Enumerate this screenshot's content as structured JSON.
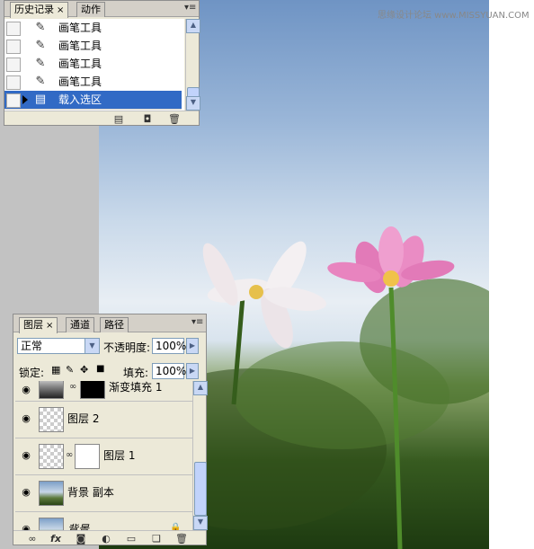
{
  "watermark": "思缘设计论坛 www.MISSYUAN.COM",
  "history_panel": {
    "tabs": [
      {
        "label": "历史记录",
        "close": "×"
      },
      {
        "label": "动作"
      }
    ],
    "menu_icon": "panel-menu-icon",
    "items": [
      {
        "label": "画笔工具",
        "icon": "brush-icon",
        "selected": false
      },
      {
        "label": "画笔工具",
        "icon": "brush-icon",
        "selected": false
      },
      {
        "label": "画笔工具",
        "icon": "brush-icon",
        "selected": false
      },
      {
        "label": "画笔工具",
        "icon": "brush-icon",
        "selected": false
      },
      {
        "label": "载入选区",
        "icon": "load-selection-icon",
        "selected": true
      }
    ],
    "footer_icons": [
      "new-document-from-state-icon",
      "snapshot-camera-icon",
      "trash-icon"
    ]
  },
  "layers_panel": {
    "tabs": [
      {
        "label": "图层",
        "close": "×"
      },
      {
        "label": "通道"
      },
      {
        "label": "路径"
      }
    ],
    "blend_mode": "正常",
    "opacity_label": "不透明度:",
    "opacity_value": "100%",
    "lock_label": "锁定:",
    "fill_label": "填充:",
    "fill_value": "100%",
    "layers": [
      {
        "name": "渐变填充 1",
        "visible": true,
        "has_mask": true
      },
      {
        "name": "图层 2",
        "visible": true,
        "has_mask": false
      },
      {
        "name": "图层 1",
        "visible": true,
        "has_mask": true
      },
      {
        "name": "背景 副本",
        "visible": true,
        "has_mask": false
      },
      {
        "name": "背景",
        "visible": true,
        "has_mask": false,
        "locked": true
      }
    ],
    "footer_icons": [
      "link-layers-icon",
      "fx-icon",
      "add-mask-icon",
      "adjustment-layer-icon",
      "group-folder-icon",
      "new-layer-icon",
      "trash-icon"
    ]
  },
  "colors": {
    "panel_bg": "#ece9d8",
    "selection": "#316ac5",
    "workspace_gray": "#c2c2c2"
  }
}
